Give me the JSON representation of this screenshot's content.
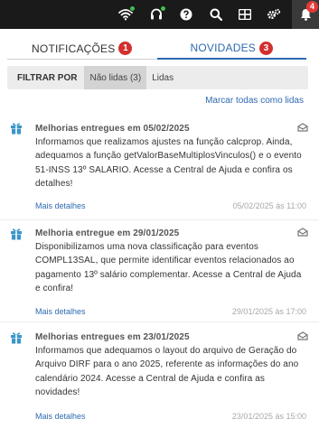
{
  "topbar": {
    "icons": [
      "wifi-icon",
      "headset-icon",
      "help-icon",
      "search-icon",
      "apps-grid-icon",
      "settings-icon",
      "bell-icon"
    ],
    "notification_count": "4",
    "status_color": "#3fbf4c"
  },
  "tabs": [
    {
      "label": "NOTIFICAÇÕES",
      "count": "1",
      "active": false
    },
    {
      "label": "NOVIDADES",
      "count": "3",
      "active": true
    }
  ],
  "filter": {
    "label": "FILTRAR POR",
    "options": [
      {
        "label": "Não lidas (3)",
        "selected": true
      },
      {
        "label": "Lidas",
        "selected": false
      }
    ]
  },
  "mark_all_label": "Marcar todas como lidas",
  "items": [
    {
      "icon": "gift-icon",
      "title": "Melhorias entregues em 05/02/2025",
      "body": "Informamos que realizamos ajustes na função calcprop. Ainda, adequamos a função getValorBaseMultiplosVinculos() e o evento 51-INSS 13º SALARIO. Acesse a Central de Ajuda e confira os detalhes!",
      "more": "Mais detalhes",
      "date": "05/02/2025 às 11:00"
    },
    {
      "icon": "gift-icon",
      "title": "Melhoria entregue em 29/01/2025",
      "body": "Disponibilizamos uma nova classificação para eventos COMPL13SAL, que permite identificar eventos relacionados ao pagamento 13º salário complementar. Acesse a Central de Ajuda e confira!",
      "more": "Mais detalhes",
      "date": "29/01/2025 às 17:00"
    },
    {
      "icon": "gift-icon",
      "title": "Melhorias entregues em 23/01/2025",
      "body": "Informamos que adequamos o layout do arquivo de Geração do Arquivo DIRF para o ano 2025, referente as informações do ano calendário 2024. Acesse a Central de Ajuda e confira as novidades!",
      "more": "Mais detalhes",
      "date": "23/01/2025 às 15:00"
    }
  ],
  "colors": {
    "topbar_bg": "#1a1a1a",
    "accent": "#2d6ab0",
    "badge": "#d32f2f",
    "gift": "#3a95c9"
  }
}
